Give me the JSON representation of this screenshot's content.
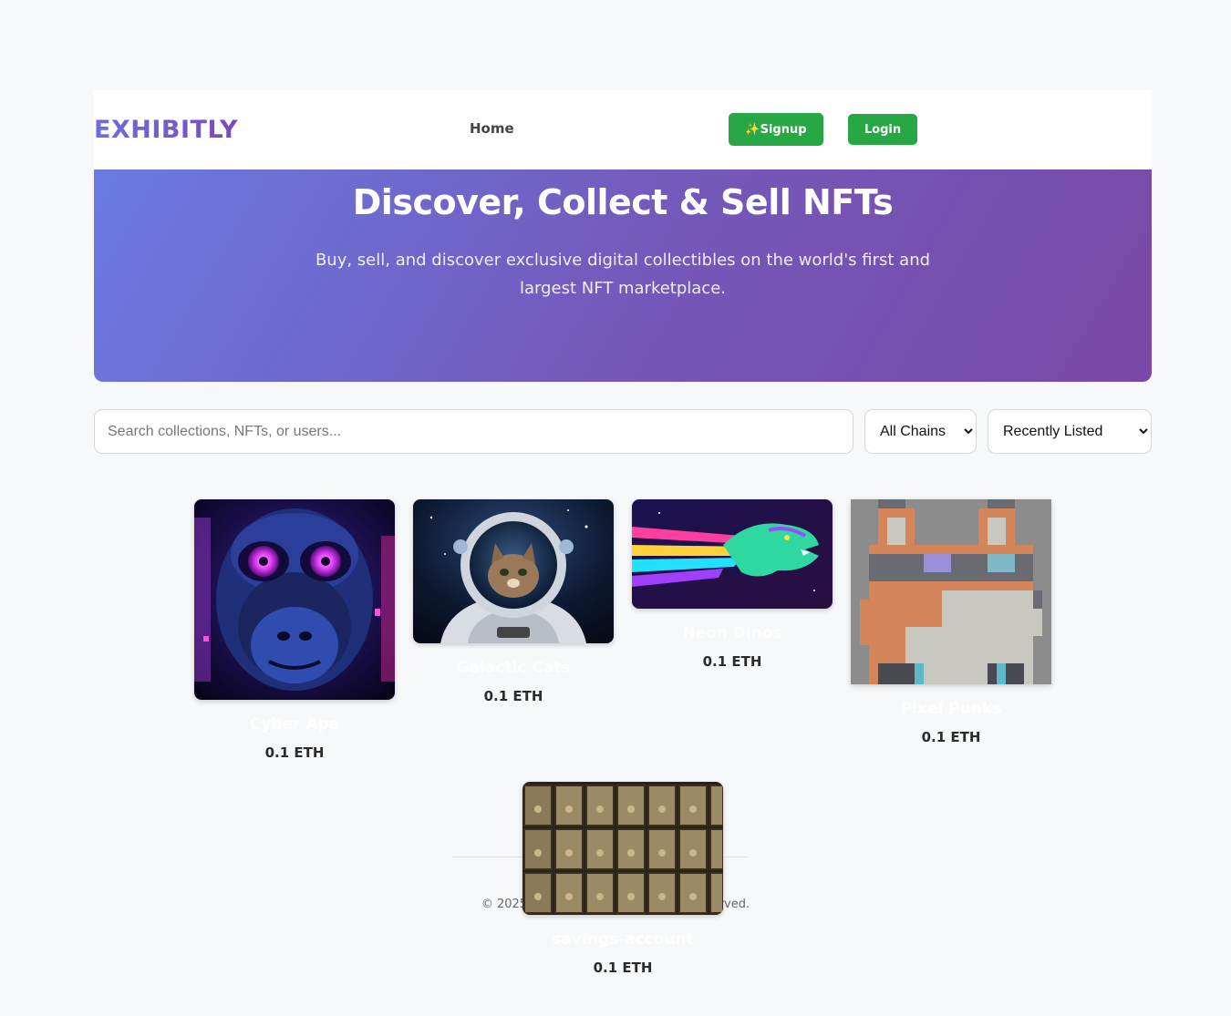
{
  "navbar": {
    "brand": "EXHIBITLY",
    "home_label": "Home",
    "signup_label": "✨Signup",
    "login_label": "Login"
  },
  "hero": {
    "title": "Discover, Collect & Sell NFTs",
    "subtitle": "Buy, sell, and discover exclusive digital collectibles on the world's first and largest NFT marketplace."
  },
  "filters": {
    "search_placeholder": "Search collections, NFTs, or users...",
    "chain_selected": "All Chains",
    "sort_selected": "Recently Listed"
  },
  "nfts": [
    {
      "name": "Cyber Ape",
      "price": "0.1 ETH",
      "image": "neon-monkey-portrait"
    },
    {
      "name": "Galactic Cats",
      "price": "0.1 ETH",
      "image": "astronaut-cat"
    },
    {
      "name": "Neon Dinos",
      "price": "0.1 ETH",
      "image": "neon-trex"
    },
    {
      "name": "Pixel Punks",
      "price": "0.1 ETH",
      "image": "pixel-fox-with-glasses"
    },
    {
      "name": "savings-account",
      "price": "0.1 ETH",
      "image": "safe-deposit-boxes"
    }
  ],
  "footer": {
    "copyright": "© 2025 NFT Marketplace. All rights reserved."
  },
  "colors": {
    "accent_green": "#28a745",
    "hero_gradient_start": "#6a7be2",
    "hero_gradient_end": "#7a48a8",
    "page_background": "#f7f8fa"
  }
}
